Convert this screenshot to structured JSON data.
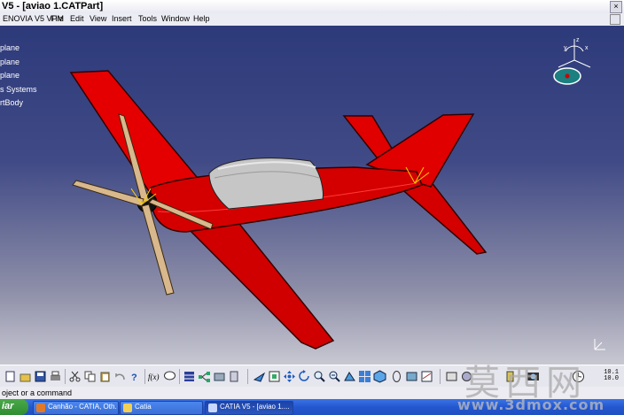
{
  "window": {
    "title": "V5 - [aviao 1.CATPart]"
  },
  "menu": [
    "ENOVIA V5 VPM",
    "File",
    "Edit",
    "View",
    "Insert",
    "Tools",
    "Window",
    "Help"
  ],
  "tree": [
    "plane",
    "plane",
    "plane",
    "s Systems",
    "rtBody"
  ],
  "compass": {
    "axis_labels": [
      "z",
      "y",
      "x"
    ]
  },
  "toolbar": {
    "scale_top": "10.1",
    "scale_bottom": "10.0"
  },
  "status": {
    "prompt": "oject or a command"
  },
  "taskbar": {
    "start_label": "iar",
    "tasks": [
      {
        "label": "Canhão - CATIA, Oth...",
        "icon": "browser-icon",
        "active": false
      },
      {
        "label": "Catia",
        "icon": "folder-icon",
        "active": false
      },
      {
        "label": "CATIA V5 - [aviao 1....",
        "icon": "catia-icon",
        "active": true
      }
    ]
  },
  "watermark": {
    "text": "莫西网",
    "url": "www.3dmox.com"
  },
  "colors": {
    "fuselage": "#d80000",
    "canopy": "#c8c8c8",
    "propeller": "#d8b88c",
    "background_top": "#2d3a7a"
  }
}
